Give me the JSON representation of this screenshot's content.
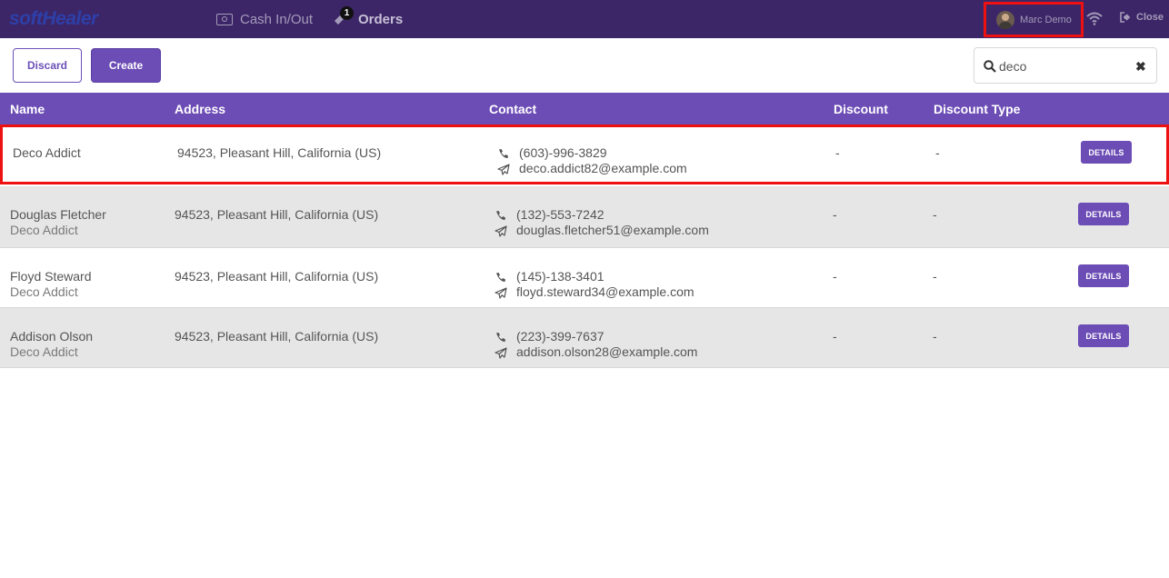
{
  "navbar": {
    "logo": "softHealer",
    "cash_label": "Cash In/Out",
    "orders_label": "Orders",
    "orders_badge": "1",
    "user_name": "Marc Demo",
    "close_label": "Close"
  },
  "actions": {
    "discard_label": "Discard",
    "create_label": "Create"
  },
  "search": {
    "value": "deco"
  },
  "table": {
    "headers": {
      "name": "Name",
      "address": "Address",
      "contact": "Contact",
      "discount": "Discount",
      "discount_type": "Discount Type"
    },
    "rows": [
      {
        "name": "Deco Addict",
        "company": "",
        "address": "94523, Pleasant Hill, California (US)",
        "phone": "(603)-996-3829",
        "email": "deco.addict82@example.com",
        "discount": "-",
        "discount_type": "-",
        "details": "DETAILS"
      },
      {
        "name": "Douglas Fletcher",
        "company": "Deco Addict",
        "address": "94523, Pleasant Hill, California (US)",
        "phone": "(132)-553-7242",
        "email": "douglas.fletcher51@example.com",
        "discount": "-",
        "discount_type": "-",
        "details": "DETAILS"
      },
      {
        "name": "Floyd Steward",
        "company": "Deco Addict",
        "address": "94523, Pleasant Hill, California (US)",
        "phone": "(145)-138-3401",
        "email": "floyd.steward34@example.com",
        "discount": "-",
        "discount_type": "-",
        "details": "DETAILS"
      },
      {
        "name": "Addison Olson",
        "company": "Deco Addict",
        "address": "94523, Pleasant Hill, California (US)",
        "phone": "(223)-399-7637",
        "email": "addison.olson28@example.com",
        "discount": "-",
        "discount_type": "-",
        "details": "DETAILS"
      }
    ]
  },
  "colors": {
    "navbar": "#3c2668",
    "accent": "#6c4cb5",
    "highlight": "#ee1111"
  }
}
